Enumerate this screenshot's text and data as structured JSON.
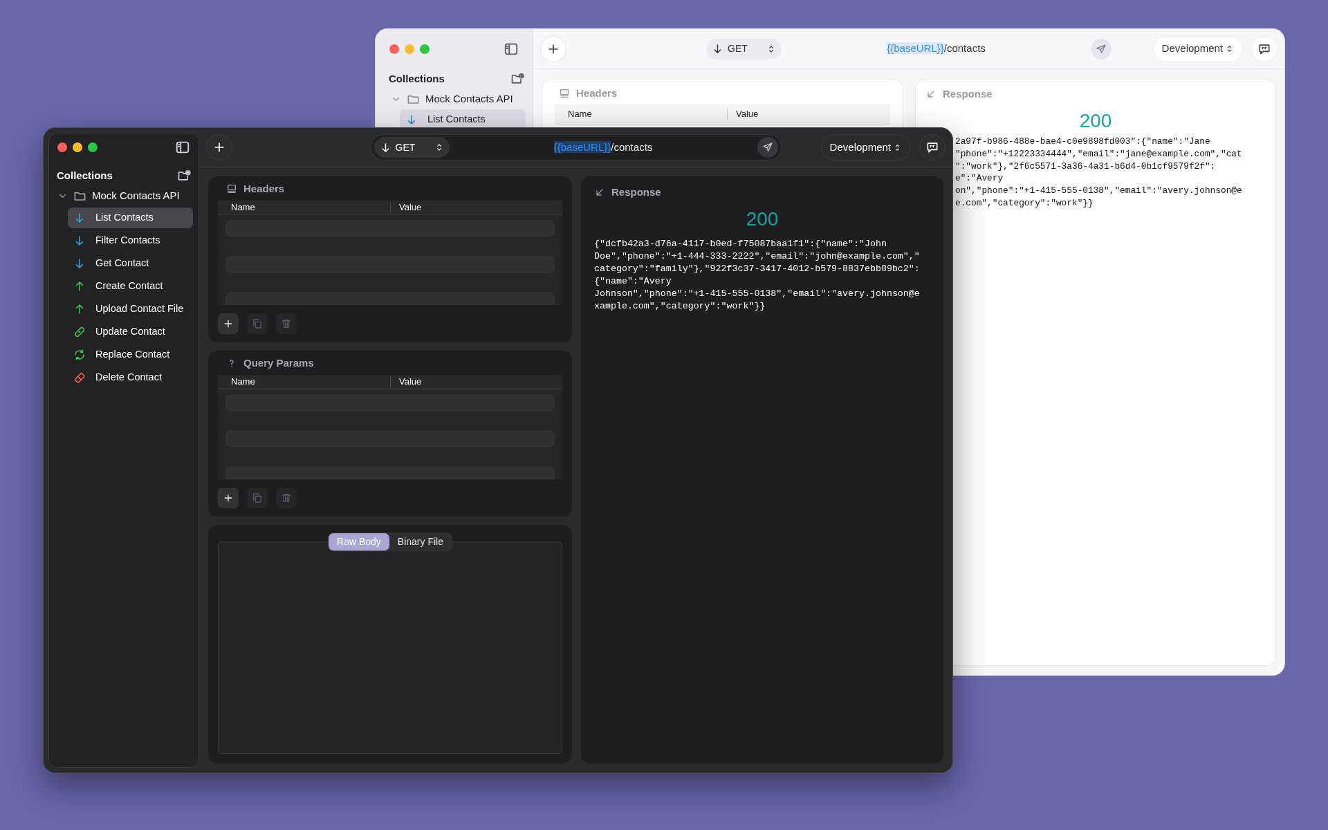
{
  "back_window": {
    "sidebar": {
      "title": "Collections",
      "collections": [
        {
          "name": "Mock Contacts API",
          "expanded": true,
          "requests": [
            {
              "name": "List Contacts",
              "kind": "get",
              "selected": true
            }
          ]
        }
      ]
    },
    "toolbar": {
      "method": "GET",
      "url_variable": "{{baseURL}}",
      "url_path": "/contacts",
      "environment": "Development"
    },
    "headers": {
      "title": "Headers",
      "columns": [
        "Name",
        "Value"
      ]
    },
    "response": {
      "title": "Response",
      "status": "200",
      "body_lines": [
        "2a97f-b986-488e-bae4-c0e9898fd003\":{\"name\":\"Jane",
        "\"phone\":\"+12223334444\",\"email\":\"jane@example.com\",\"cat",
        "\":\"work\"},\"2f6c5571-3a36-4a31-b6d4-0b1cf9579f2f\":",
        "e\":\"Avery",
        "on\",\"phone\":\"+1-415-555-0138\",\"email\":\"avery.johnson@e",
        "e.com\",\"category\":\"work\"}}"
      ]
    }
  },
  "front_window": {
    "sidebar": {
      "title": "Collections",
      "collections": [
        {
          "name": "Mock Contacts API",
          "expanded": true,
          "requests": [
            {
              "name": "List Contacts",
              "kind": "get",
              "selected": true
            },
            {
              "name": "Filter Contacts",
              "kind": "get",
              "selected": false
            },
            {
              "name": "Get Contact",
              "kind": "get",
              "selected": false
            },
            {
              "name": "Create Contact",
              "kind": "post",
              "selected": false
            },
            {
              "name": "Upload Contact File",
              "kind": "post",
              "selected": false
            },
            {
              "name": "Update Contact",
              "kind": "patch",
              "selected": false
            },
            {
              "name": "Replace Contact",
              "kind": "put",
              "selected": false
            },
            {
              "name": "Delete Contact",
              "kind": "delete",
              "selected": false
            }
          ]
        }
      ]
    },
    "toolbar": {
      "method": "GET",
      "url_variable": "{{baseURL}}",
      "url_path": "/contacts",
      "environment": "Development"
    },
    "headers": {
      "title": "Headers",
      "columns": [
        "Name",
        "Value"
      ],
      "actions": [
        {
          "kind": "add",
          "disabled": false
        },
        {
          "kind": "copy",
          "disabled": true
        },
        {
          "kind": "delete",
          "disabled": true
        }
      ]
    },
    "query_params": {
      "title": "Query Params",
      "columns": [
        "Name",
        "Value"
      ],
      "actions": [
        {
          "kind": "add",
          "disabled": false
        },
        {
          "kind": "copy",
          "disabled": true
        },
        {
          "kind": "delete",
          "disabled": true
        }
      ]
    },
    "body": {
      "tabs": [
        {
          "label": "Raw Body",
          "selected": true
        },
        {
          "label": "Binary File",
          "selected": false
        }
      ]
    },
    "response": {
      "title": "Response",
      "status": "200",
      "body_lines": [
        "{\"dcfb42a3-d76a-4117-b0ed-f75087baa1f1\":{\"name\":\"John",
        "Doe\",\"phone\":\"+1-444-333-2222\",\"email\":\"john@example.com\",\"",
        "category\":\"family\"},\"922f3c37-3417-4012-b579-8837ebb89bc2\":",
        "{\"name\":\"Avery",
        "Johnson\",\"phone\":\"+1-415-555-0138\",\"email\":\"avery.johnson@e",
        "xample.com\",\"category\":\"work\"}}"
      ]
    }
  }
}
